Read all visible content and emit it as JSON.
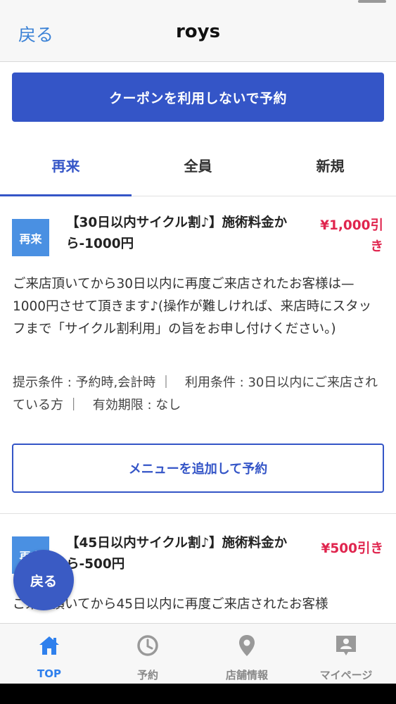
{
  "header": {
    "back_label": "戻る",
    "title": "roys"
  },
  "primary_action": {
    "label": "クーポンを利用しないで予約"
  },
  "tabs": [
    {
      "label": "再来",
      "active": true
    },
    {
      "label": "全員",
      "active": false
    },
    {
      "label": "新規",
      "active": false
    }
  ],
  "coupons": [
    {
      "badge": "再来",
      "title": "【30日以内サイクル割♪】施術料金から-1000円",
      "price": "¥1,000引き",
      "description": "ご来店頂いてから30日以内に再度ご来店されたお客様は—1000円させて頂きます♪(操作が難しければ、来店時にスタッフまで「サイクル割利用」の旨をお申し付けください。)",
      "conditions": "提示条件 : 予約時,会計時 ｜　利用条件 : 30日以内にご来店されている方 ｜　有効期限 : なし",
      "button_label": "メニューを追加して予約"
    },
    {
      "badge": "再来",
      "title": "【45日以内サイクル割♪】施術料金から-500円",
      "price": "¥500引き",
      "description": "ご来店頂いてから45日以内に再度ご来店されたお客様"
    }
  ],
  "floating_back": {
    "label": "戻る"
  },
  "bottom_nav": [
    {
      "label": "TOP",
      "icon": "home-icon",
      "active": true
    },
    {
      "label": "予約",
      "icon": "clock-icon",
      "active": false
    },
    {
      "label": "店舗情報",
      "icon": "map-pin-icon",
      "active": false
    },
    {
      "label": "マイページ",
      "icon": "user-card-icon",
      "active": false
    }
  ],
  "colors": {
    "accent": "#3455c7",
    "price": "#e0254e",
    "badge": "#4a90e2",
    "nav_active": "#2f80ed"
  }
}
